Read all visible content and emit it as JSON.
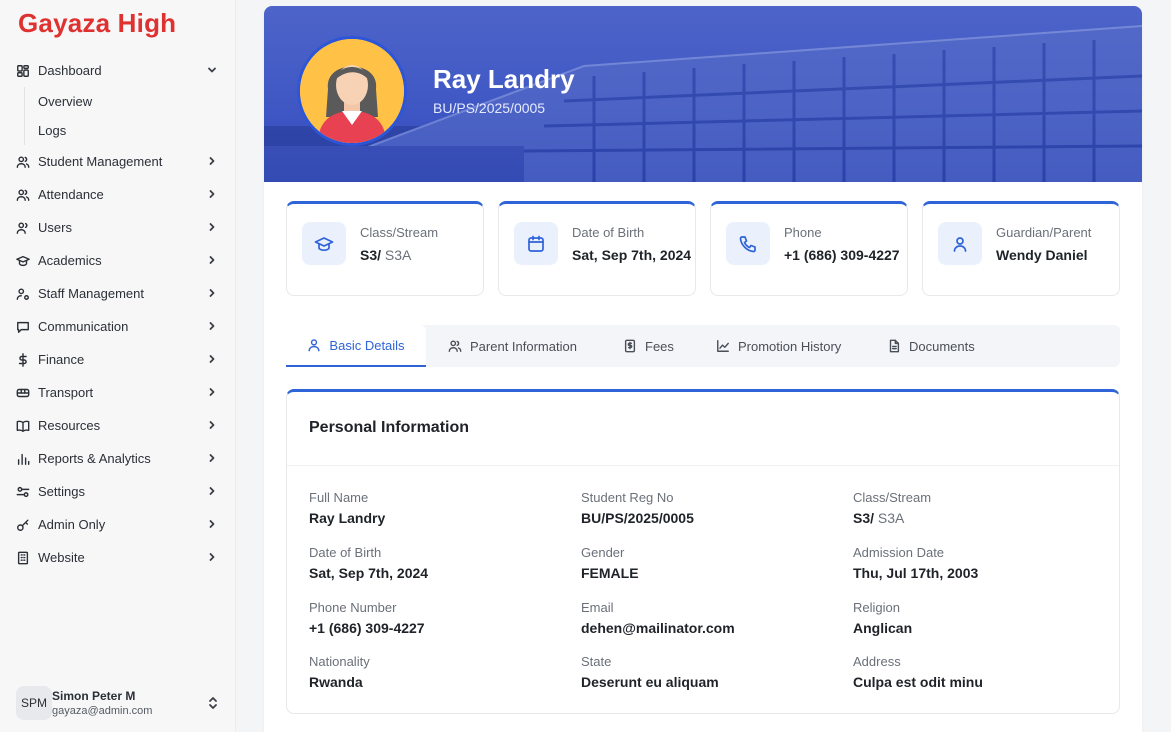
{
  "brand": "Gayaza High",
  "sidebar": {
    "items": [
      {
        "label": "Dashboard",
        "icon": "grid-icon",
        "expanded": true,
        "children": [
          "Overview",
          "Logs"
        ]
      },
      {
        "label": "Student Management",
        "icon": "users-icon"
      },
      {
        "label": "Attendance",
        "icon": "users-icon"
      },
      {
        "label": "Users",
        "icon": "user-icon"
      },
      {
        "label": "Academics",
        "icon": "graduation-cap-icon"
      },
      {
        "label": "Staff Management",
        "icon": "user-cog-icon"
      },
      {
        "label": "Communication",
        "icon": "message-icon"
      },
      {
        "label": "Finance",
        "icon": "dollar-icon"
      },
      {
        "label": "Transport",
        "icon": "bus-icon"
      },
      {
        "label": "Resources",
        "icon": "book-icon"
      },
      {
        "label": "Reports & Analytics",
        "icon": "bar-chart-icon"
      },
      {
        "label": "Settings",
        "icon": "settings-icon"
      },
      {
        "label": "Admin Only",
        "icon": "key-icon"
      },
      {
        "label": "Website",
        "icon": "building-icon"
      }
    ]
  },
  "user": {
    "initials": "SPM",
    "name": "Simon Peter M",
    "email": "gayaza@admin.com"
  },
  "profile": {
    "name": "Ray Landry",
    "reg_no": "BU/PS/2025/0005"
  },
  "cards": [
    {
      "label": "Class/Stream",
      "value": "S3/",
      "value_muted": " S3A",
      "icon": "graduation-cap-icon"
    },
    {
      "label": "Date of Birth",
      "value": "Sat, Sep 7th, 2024",
      "icon": "calendar-icon"
    },
    {
      "label": "Phone",
      "value": "+1 (686) 309-4227",
      "icon": "phone-icon"
    },
    {
      "label": "Guardian/Parent",
      "value": "Wendy Daniel",
      "icon": "user-icon"
    }
  ],
  "tabs": [
    {
      "label": "Basic Details",
      "icon": "user-icon",
      "active": true
    },
    {
      "label": "Parent Information",
      "icon": "users-icon"
    },
    {
      "label": "Fees",
      "icon": "receipt-icon"
    },
    {
      "label": "Promotion History",
      "icon": "line-chart-icon"
    },
    {
      "label": "Documents",
      "icon": "document-icon"
    }
  ],
  "personal": {
    "title": "Personal Information",
    "fields": [
      {
        "label": "Full Name",
        "value": "Ray Landry"
      },
      {
        "label": "Student Reg No",
        "value": "BU/PS/2025/0005"
      },
      {
        "label": "Class/Stream",
        "value": "S3/",
        "value_muted": " S3A"
      },
      {
        "label": "Date of Birth",
        "value": "Sat, Sep 7th, 2024"
      },
      {
        "label": "Gender",
        "value": "FEMALE"
      },
      {
        "label": "Admission Date",
        "value": "Thu, Jul 17th, 2003"
      },
      {
        "label": "Phone Number",
        "value": "+1 (686) 309-4227"
      },
      {
        "label": "Email",
        "value": "dehen@mailinator.com"
      },
      {
        "label": "Religion",
        "value": "Anglican"
      },
      {
        "label": "Nationality",
        "value": "Rwanda"
      },
      {
        "label": "State",
        "value": "Deserunt eu aliquam"
      },
      {
        "label": "Address",
        "value": "Culpa est odit minu"
      }
    ]
  },
  "colors": {
    "brand": "#e03131",
    "accent": "#2f63d8"
  }
}
